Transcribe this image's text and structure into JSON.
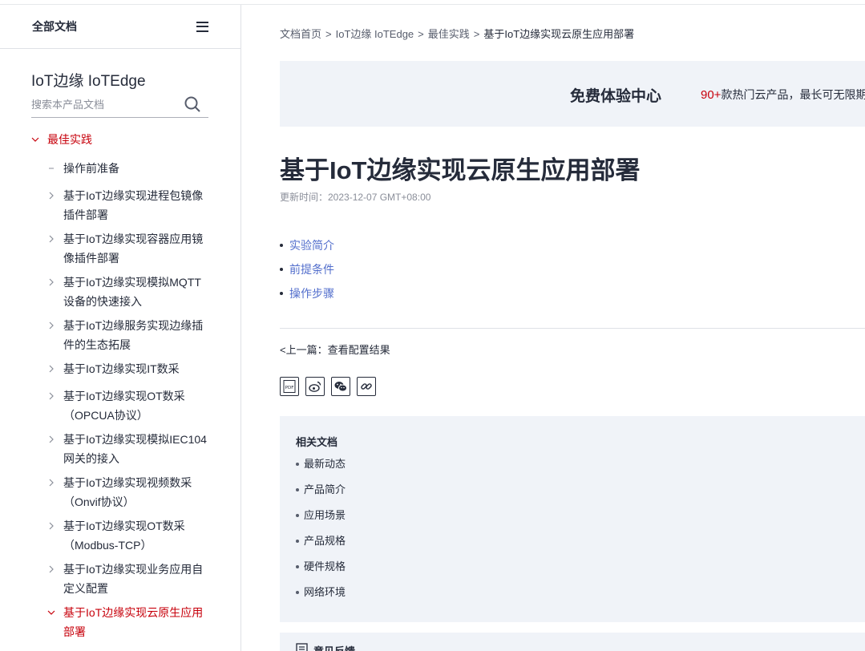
{
  "sidebar": {
    "header_title": "全部文档",
    "product_title": "IoT边缘 IoTEdge",
    "search_placeholder": "搜索本产品文档",
    "category": "最佳实践",
    "items": [
      {
        "label": "操作前准备"
      },
      {
        "label": "基于IoT边缘实现进程包镜像插件部署"
      },
      {
        "label": "基于IoT边缘实现容器应用镜像插件部署"
      },
      {
        "label": "基于IoT边缘实现模拟MQTT设备的快速接入"
      },
      {
        "label": "基于IoT边缘服务实现边缘插件的生态拓展"
      },
      {
        "label": "基于IoT边缘实现IT数采"
      },
      {
        "label": "基于IoT边缘实现OT数采（OPCUA协议）"
      },
      {
        "label": "基于IoT边缘实现模拟IEC104网关的接入"
      },
      {
        "label": "基于IoT边缘实现视频数采（Onvif协议）"
      },
      {
        "label": "基于IoT边缘实现OT数采（Modbus-TCP）"
      },
      {
        "label": "基于IoT边缘实现业务应用自定义配置"
      },
      {
        "label": "基于IoT边缘实现云原生应用部署"
      }
    ]
  },
  "breadcrumb": {
    "items": [
      "文档首页",
      "IoT边缘 IoTEdge",
      "最佳实践",
      "基于IoT边缘实现云原生应用部署"
    ],
    "separator": ">"
  },
  "banner": {
    "title": "免费体验中心",
    "highlight": "90+",
    "text": "款热门云产品，最长可无限期"
  },
  "article": {
    "title": "基于IoT边缘实现云原生应用部署",
    "updated": "更新时间：2023-12-07 GMT+08:00",
    "toc": [
      "实验简介",
      "前提条件",
      "操作步骤"
    ],
    "prev": "<上一篇：查看配置结果"
  },
  "share": {
    "icons": [
      "pdf-icon",
      "weibo-icon",
      "wechat-icon",
      "link-icon"
    ]
  },
  "related": {
    "title": "相关文档",
    "items": [
      "最新动态",
      "产品简介",
      "应用场景",
      "产品规格",
      "硬件规格",
      "网络环境"
    ]
  },
  "feedback": {
    "title": "意见反馈"
  },
  "colors": {
    "accent_red": "#c7000b",
    "link_blue": "#526ecc",
    "panel_bg": "#f0f3f8",
    "text": "#252b3a"
  }
}
